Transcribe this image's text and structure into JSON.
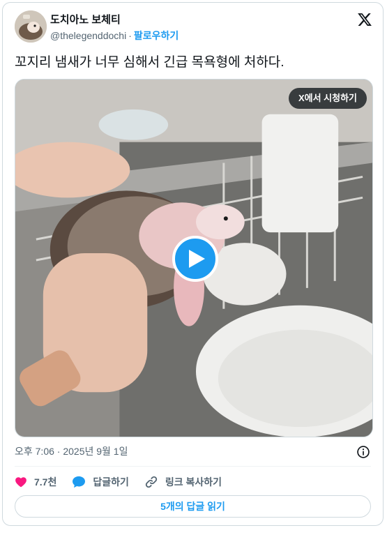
{
  "author": {
    "name": "도치아노 보체티",
    "handle": "@thelegenddochi",
    "separator": "·",
    "follow_label": "팔로우하기"
  },
  "tweet": {
    "text": "꼬지리 냄새가 너무 심해서 긴급 목욕형에 처하다.",
    "timestamp": "오후 7:06 · 2025년 9월 1일"
  },
  "media": {
    "watch_label": "X에서 시청하기",
    "play_icon": "play-icon"
  },
  "actions": {
    "likes": "7.7천",
    "reply_label": "답글하기",
    "copy_link_label": "링크 복사하기"
  },
  "read_replies_label": "5개의 답글 읽기",
  "colors": {
    "accent": "#1d9bf0",
    "like": "#f91880",
    "text": "#0f1419",
    "muted": "#536471",
    "border": "#cfd9de"
  }
}
